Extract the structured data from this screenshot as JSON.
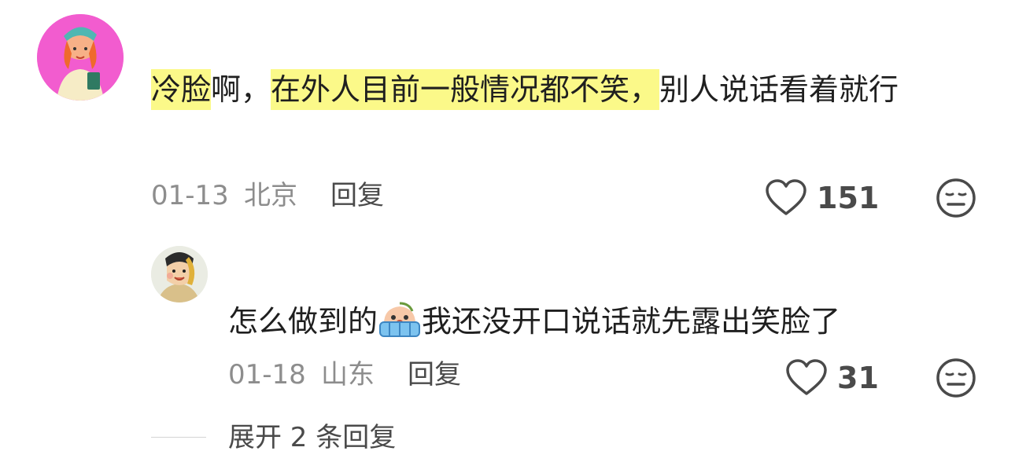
{
  "comments": [
    {
      "segments": [
        {
          "text": "冷脸",
          "highlight": true
        },
        {
          "text": "啊，",
          "highlight": false
        },
        {
          "text": "在外人目前一般情况都不笑，",
          "highlight": true
        },
        {
          "text": "别人说话看着就行",
          "highlight": false
        }
      ],
      "date": "01-13",
      "location": "北京",
      "reply_label": "回复",
      "like_count": "151"
    },
    {
      "text_before_emoji": "怎么做到的",
      "emoji_name": "crying-face-emoji",
      "text_after_emoji": "我还没开口说话就先露出笑脸了",
      "date": "01-18",
      "location": "山东",
      "reply_label": "回复",
      "like_count": "31"
    }
  ],
  "expand_label": "展开 2 条回复",
  "colors": {
    "highlight": "#fbf989",
    "meta_text": "#8d8d8d",
    "body_text": "#1f1f1f",
    "icon": "#4a4a4a"
  },
  "icons": [
    "heart-icon",
    "dislike-face-icon"
  ]
}
